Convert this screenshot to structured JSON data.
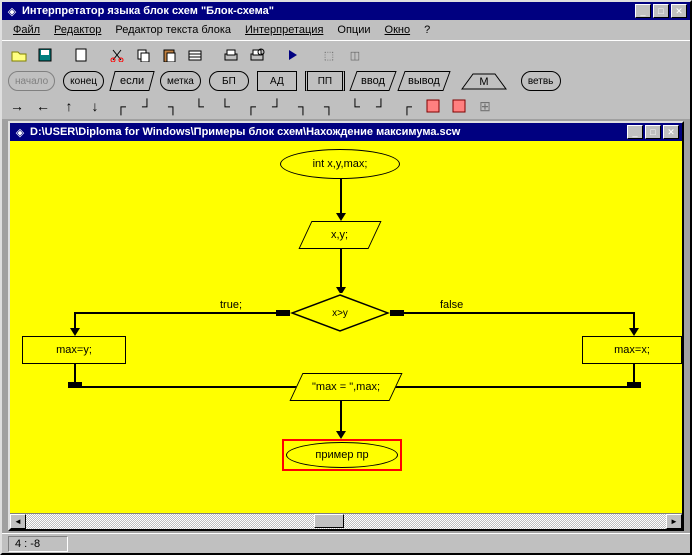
{
  "window": {
    "title": "Интерпретатор языка блок схем \"Блок-схема\"",
    "titlebar_icon": "◈"
  },
  "menu": {
    "file": "Файл",
    "editor": "Редактор",
    "block_text_editor": "Редактор текста блока",
    "interpretation": "Интерпретация",
    "options": "Опции",
    "window": "Окно",
    "help": "?"
  },
  "shapes_row": {
    "start": "начало",
    "end": "конец",
    "if": "если",
    "label": "метка",
    "bp": "БП",
    "ad": "АД",
    "pp": "ПП",
    "input": "ввод",
    "output": "вывод",
    "m": "М",
    "branch": "ветвь"
  },
  "mdi": {
    "title": "D:\\USER\\Diploma for Windows\\Примеры блок схем\\Нахождение максимума.scw",
    "titlebar_icon": "◈"
  },
  "chart_data": {
    "type": "flowchart",
    "nodes": [
      {
        "id": "n1",
        "shape": "terminator",
        "text": "int x,y,max;"
      },
      {
        "id": "n2",
        "shape": "io",
        "text": "x,y;"
      },
      {
        "id": "n3",
        "shape": "decision",
        "text": "x>y"
      },
      {
        "id": "n4",
        "shape": "process",
        "text": "max=y;"
      },
      {
        "id": "n5",
        "shape": "process",
        "text": "max=x;"
      },
      {
        "id": "n6",
        "shape": "io",
        "text": "\"max = \",max;"
      },
      {
        "id": "n7",
        "shape": "terminator",
        "text": "пример пр",
        "highlighted": true
      }
    ],
    "edges": [
      {
        "from": "n1",
        "to": "n2"
      },
      {
        "from": "n2",
        "to": "n3"
      },
      {
        "from": "n3",
        "to": "n4",
        "label": "true;"
      },
      {
        "from": "n3",
        "to": "n5",
        "label": "false"
      },
      {
        "from": "n4",
        "to": "n6"
      },
      {
        "from": "n5",
        "to": "n6"
      },
      {
        "from": "n6",
        "to": "n7"
      }
    ]
  },
  "status": {
    "coords": "4 : -8"
  }
}
